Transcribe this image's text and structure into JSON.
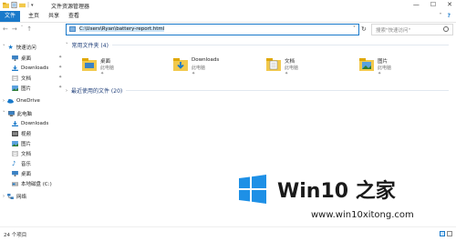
{
  "window": {
    "title": "文件资源管理器",
    "controls": [
      "—",
      "☐",
      "✕"
    ]
  },
  "ribbon": {
    "tabs": [
      "文件",
      "主页",
      "共享",
      "查看"
    ],
    "right_controls": [
      "˅",
      "?"
    ]
  },
  "navigation": {
    "address_path": "C:\\Users\\Ryan\\battery-report.html",
    "search_placeholder": "搜索\"快速访问\""
  },
  "sidebar": {
    "quick_access_label": "快速访问",
    "quick_items": [
      {
        "label": "桌面",
        "icon": "desktop-icon"
      },
      {
        "label": "Downloads",
        "icon": "download-icon"
      },
      {
        "label": "文档",
        "icon": "documents-icon"
      },
      {
        "label": "图片",
        "icon": "pictures-icon"
      }
    ],
    "onedrive_label": "OneDrive",
    "this_pc_label": "此电脑",
    "pc_items": [
      {
        "label": "Downloads",
        "icon": "download-icon"
      },
      {
        "label": "视频",
        "icon": "videos-icon"
      },
      {
        "label": "图片",
        "icon": "pictures-icon"
      },
      {
        "label": "文档",
        "icon": "documents-icon"
      },
      {
        "label": "音乐",
        "icon": "music-icon"
      },
      {
        "label": "桌面",
        "icon": "desktop-icon"
      },
      {
        "label": "本地磁盘 (C:)",
        "icon": "drive-icon"
      }
    ],
    "network_label": "网络"
  },
  "content": {
    "frequent_header": "常用文件夹 (4)",
    "recent_header": "最近使用的文件 (20)",
    "folders": [
      {
        "name": "桌面",
        "location": "此电脑",
        "icon": "desktop-folder-icon"
      },
      {
        "name": "Downloads",
        "location": "此电脑",
        "icon": "downloads-folder-icon"
      },
      {
        "name": "文档",
        "location": "此电脑",
        "icon": "documents-folder-icon"
      },
      {
        "name": "图片",
        "location": "此电脑",
        "icon": "pictures-folder-icon"
      }
    ]
  },
  "status": {
    "item_count": "24 个项目"
  },
  "watermark": {
    "brand": "Win10 之家",
    "site": "www.win10xitong.com"
  },
  "colors": {
    "accent": "#1979ca",
    "logo_blue": "#1e90e6",
    "folder_yellow": "#f2c94c"
  }
}
